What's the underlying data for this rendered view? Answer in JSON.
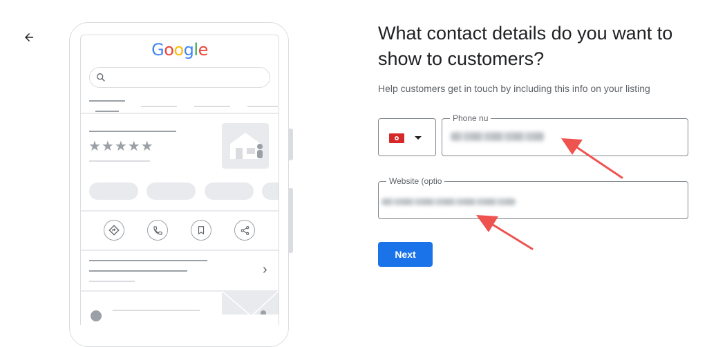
{
  "header": {
    "back_icon": "arrow-back-icon"
  },
  "preview": {
    "logo_letters": [
      {
        "ch": "G",
        "color": "#4285F4"
      },
      {
        "ch": "o",
        "color": "#EA4335"
      },
      {
        "ch": "o",
        "color": "#FBBC05"
      },
      {
        "ch": "g",
        "color": "#4285F4"
      },
      {
        "ch": "l",
        "color": "#34A853"
      },
      {
        "ch": "e",
        "color": "#EA4335"
      }
    ],
    "stars": "★★★★★",
    "action_icons": [
      "directions-icon",
      "call-icon",
      "bookmark-icon",
      "share-icon"
    ],
    "chevron": "›"
  },
  "main": {
    "title": "What contact details do you want to show to customers?",
    "subtitle": "Help customers get in touch by including this info on your listing",
    "country_flag": "hong-kong-flag-icon",
    "phone_label": "Phone nu",
    "website_label": "Website (optio",
    "next_label": "Next"
  },
  "colors": {
    "accent": "#1a73e8",
    "annotation_arrow": "#ef5350",
    "flag_red": "#d62828"
  }
}
